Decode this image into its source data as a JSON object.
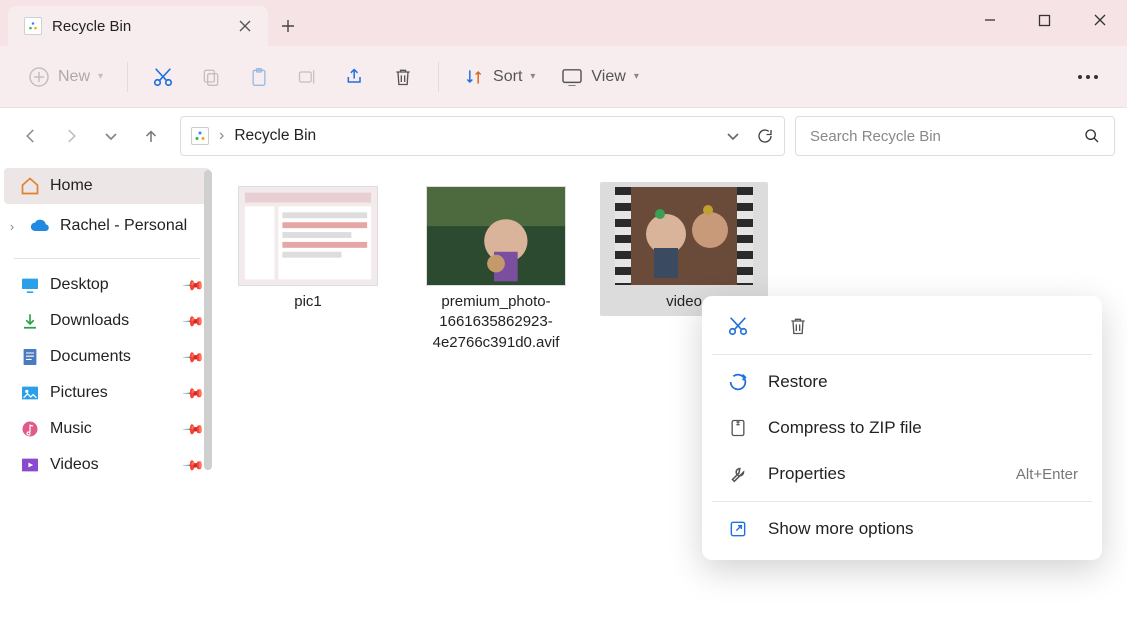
{
  "tab": {
    "title": "Recycle Bin"
  },
  "toolbar": {
    "new": "New",
    "sort": "Sort",
    "view": "View"
  },
  "breadcrumb": {
    "location": "Recycle Bin"
  },
  "search": {
    "placeholder": "Search Recycle Bin"
  },
  "sidebar": {
    "home": "Home",
    "cloud": "Rachel - Personal",
    "items": [
      {
        "label": "Desktop"
      },
      {
        "label": "Downloads"
      },
      {
        "label": "Documents"
      },
      {
        "label": "Pictures"
      },
      {
        "label": "Music"
      },
      {
        "label": "Videos"
      }
    ]
  },
  "files": [
    {
      "name": "pic1"
    },
    {
      "name": "premium_photo-1661635862923-4e2766c391d0.avif"
    },
    {
      "name": "video"
    }
  ],
  "context_menu": {
    "restore": "Restore",
    "zip": "Compress to ZIP file",
    "properties": "Properties",
    "properties_kbd": "Alt+Enter",
    "more": "Show more options"
  }
}
